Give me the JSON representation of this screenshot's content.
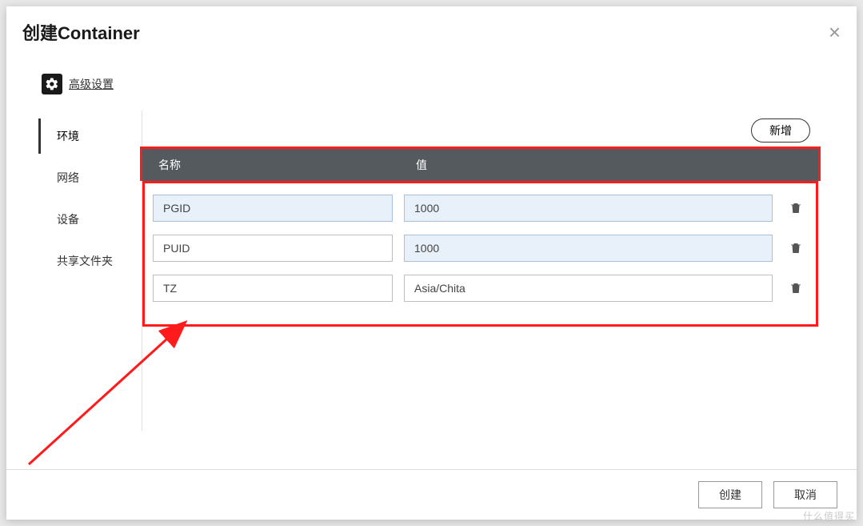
{
  "dialog": {
    "title": "创建Container"
  },
  "adv": {
    "label": "高级设置"
  },
  "sidebar": {
    "items": [
      {
        "label": "环境"
      },
      {
        "label": "网络"
      },
      {
        "label": "设备"
      },
      {
        "label": "共享文件夹"
      }
    ]
  },
  "toolbar": {
    "add_label": "新增"
  },
  "table": {
    "header_name": "名称",
    "header_value": "值",
    "rows": [
      {
        "name": "PGID",
        "value": "1000",
        "name_hl": true,
        "value_hl": true
      },
      {
        "name": "PUID",
        "value": "1000",
        "name_hl": false,
        "value_hl": true
      },
      {
        "name": "TZ",
        "value": "Asia/Chita",
        "name_hl": false,
        "value_hl": false
      }
    ]
  },
  "footer": {
    "create_label": "创建",
    "cancel_label": "取消"
  },
  "watermark": "什么值得买"
}
